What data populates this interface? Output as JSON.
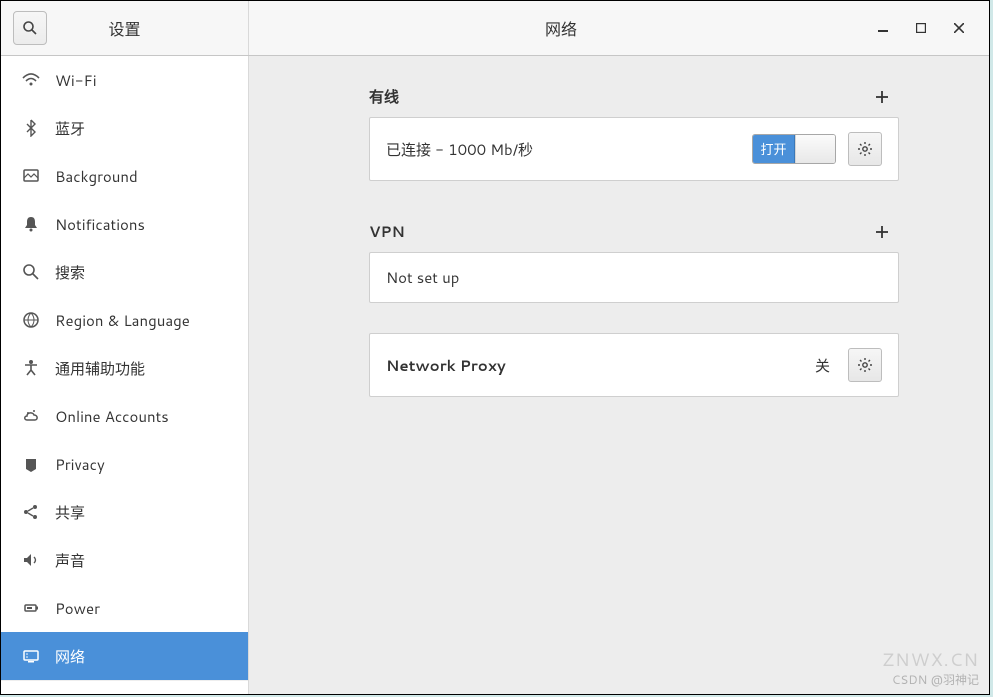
{
  "header": {
    "left_title": "设置",
    "right_title": "网络"
  },
  "sidebar": {
    "items": [
      {
        "icon": "wifi",
        "label": "Wi-Fi",
        "active": false
      },
      {
        "icon": "bluetooth",
        "label": "蓝牙",
        "active": false
      },
      {
        "icon": "background",
        "label": "Background",
        "active": false
      },
      {
        "icon": "notifications",
        "label": "Notifications",
        "active": false
      },
      {
        "icon": "search",
        "label": "搜索",
        "active": false
      },
      {
        "icon": "region",
        "label": "Region & Language",
        "active": false
      },
      {
        "icon": "accessibility",
        "label": "通用辅助功能",
        "active": false
      },
      {
        "icon": "online-accounts",
        "label": "Online Accounts",
        "active": false
      },
      {
        "icon": "privacy",
        "label": "Privacy",
        "active": false
      },
      {
        "icon": "share",
        "label": "共享",
        "active": false
      },
      {
        "icon": "sound",
        "label": "声音",
        "active": false
      },
      {
        "icon": "power",
        "label": "Power",
        "active": false
      },
      {
        "icon": "network",
        "label": "网络",
        "active": true
      }
    ]
  },
  "content": {
    "wired": {
      "title": "有线",
      "status": "已连接 - 1000 Mb/秒",
      "toggle_label": "打开"
    },
    "vpn": {
      "title": "VPN",
      "status": "Not set up"
    },
    "proxy": {
      "title": "Network Proxy",
      "status": "关"
    }
  },
  "watermark": {
    "line1": "ZNWX.CN",
    "line2": "CSDN @羽神记"
  }
}
